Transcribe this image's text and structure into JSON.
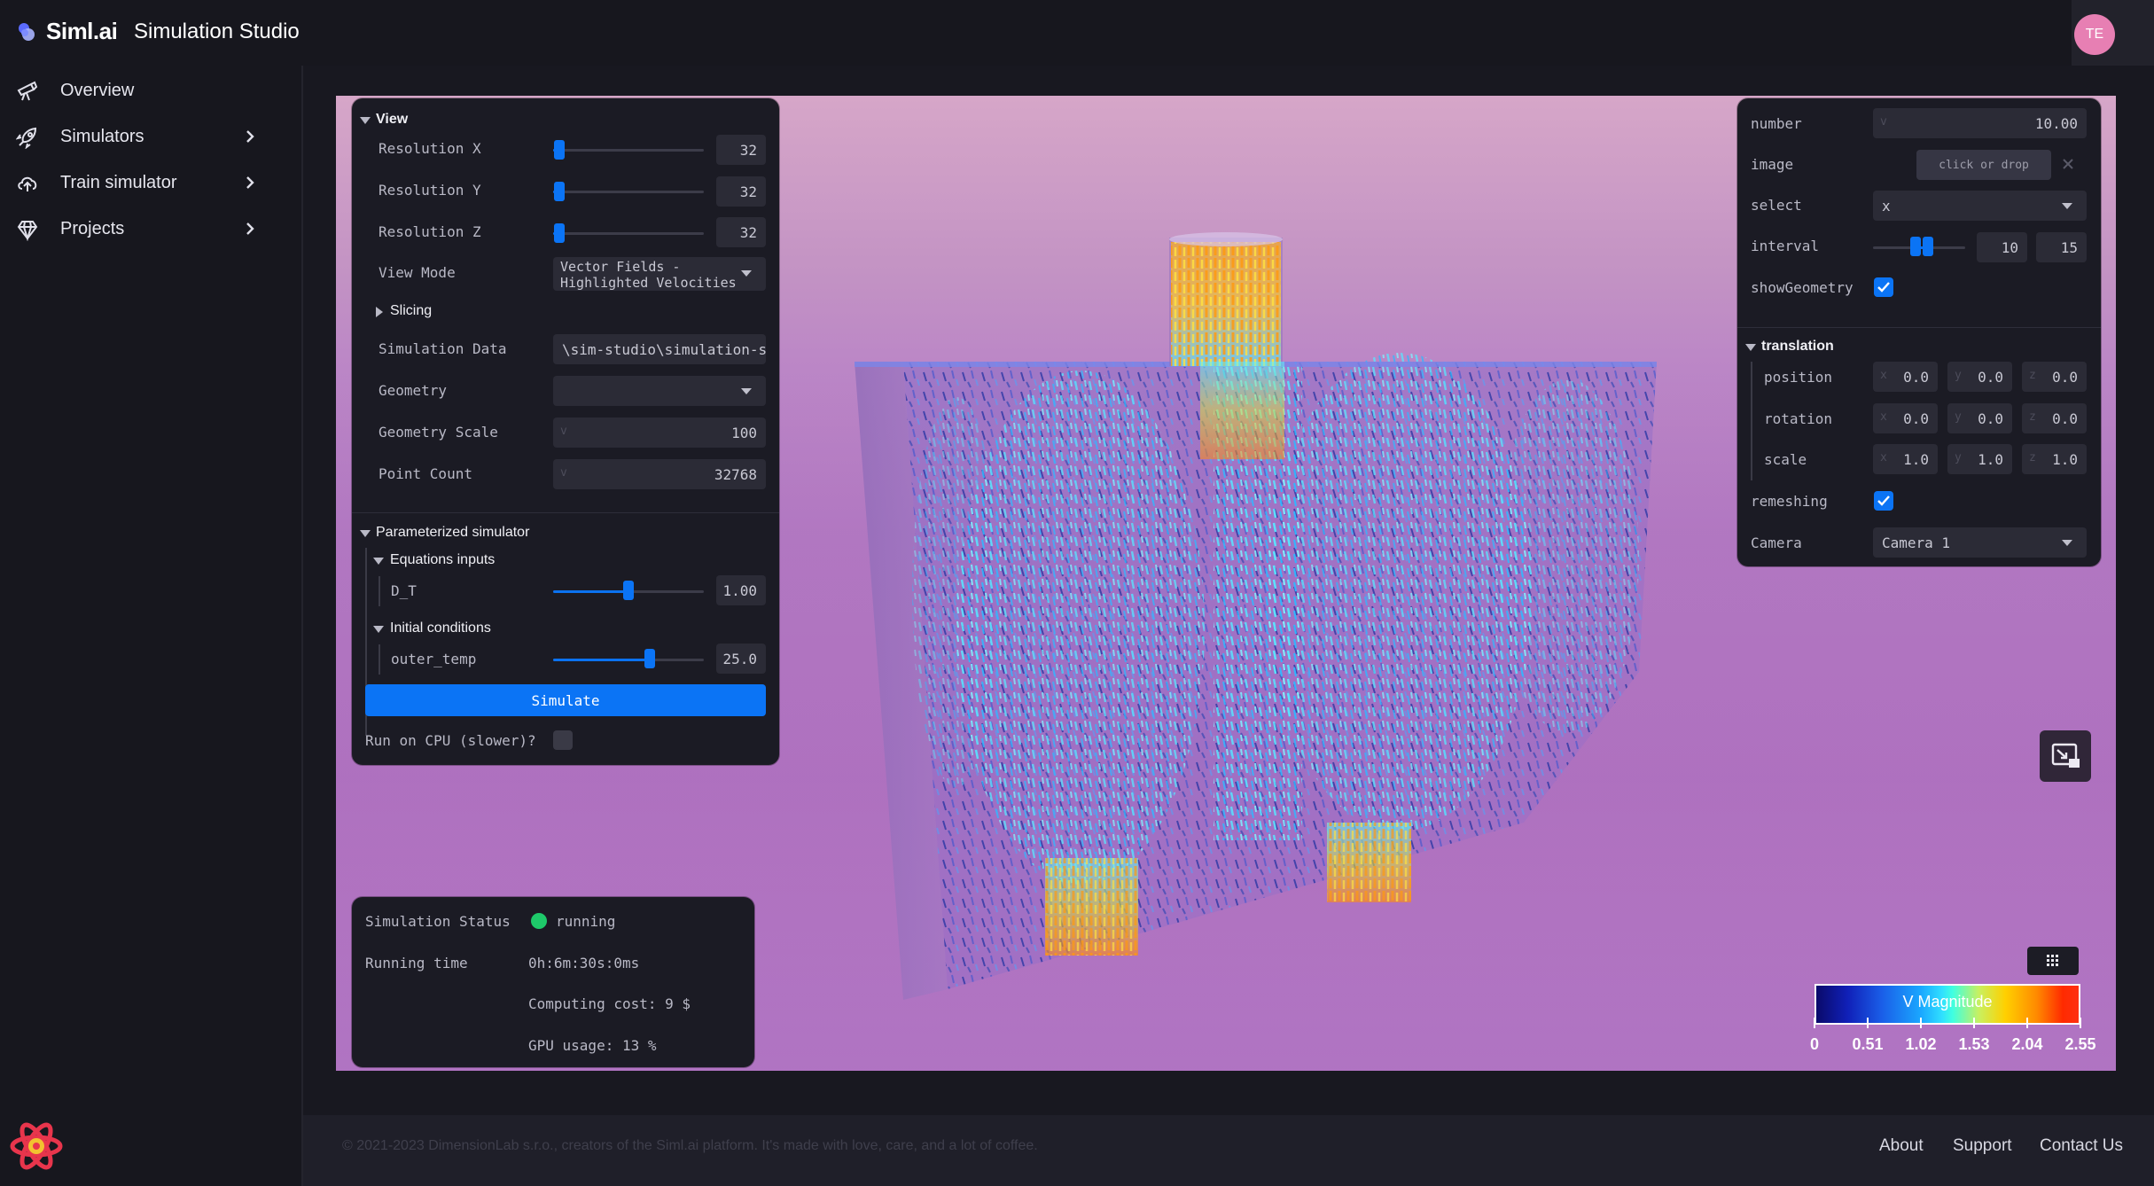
{
  "app": {
    "logo_text": "Siml.ai",
    "title": "Simulation Studio",
    "avatar_initials": "TE"
  },
  "sidebar": {
    "items": [
      {
        "label": "Overview",
        "icon": "telescope-icon",
        "has_chevron": false
      },
      {
        "label": "Simulators",
        "icon": "rocket-icon",
        "has_chevron": true
      },
      {
        "label": "Train simulator",
        "icon": "cloud-upload-icon",
        "has_chevron": true
      },
      {
        "label": "Projects",
        "icon": "diamond-icon",
        "has_chevron": true
      }
    ]
  },
  "view_panel": {
    "title": "View",
    "resolution_x": {
      "label": "Resolution X",
      "value": "32",
      "fraction": 0.04
    },
    "resolution_y": {
      "label": "Resolution Y",
      "value": "32",
      "fraction": 0.04
    },
    "resolution_z": {
      "label": "Resolution Z",
      "value": "32",
      "fraction": 0.04
    },
    "view_mode": {
      "label": "View Mode",
      "value_line1": "Vector Fields -",
      "value_line2": "Highlighted Velocities"
    },
    "slicing": "Slicing",
    "simulation_data": {
      "label": "Simulation Data",
      "value": "\\sim-studio\\simulation-st"
    },
    "geometry": {
      "label": "Geometry",
      "value": ""
    },
    "geometry_scale": {
      "label": "Geometry Scale",
      "value": "100",
      "axis": "v"
    },
    "point_count": {
      "label": "Point Count",
      "value": "32768",
      "axis": "v"
    },
    "param_sim": {
      "title": "Parameterized simulator",
      "equations_title": "Equations inputs",
      "dt": {
        "label": "D_T",
        "value": "1.00",
        "fraction": 0.5
      },
      "initial_title": "Initial conditions",
      "outer_temp": {
        "label": "outer_temp",
        "value": "25.0",
        "fraction": 0.64
      }
    },
    "simulate_label": "Simulate",
    "cpu_label": "Run on CPU (slower)?"
  },
  "right_panel": {
    "number": {
      "label": "number",
      "value": "10.00",
      "axis": "v"
    },
    "image": {
      "label": "image",
      "placeholder": "click or drop"
    },
    "select": {
      "label": "select",
      "value": "x"
    },
    "interval": {
      "label": "interval",
      "min": "10",
      "max": "15",
      "low_fraction": 0.46,
      "high_fraction": 0.6
    },
    "show_geometry": {
      "label": "showGeometry",
      "checked": true
    },
    "translation": {
      "title": "translation",
      "position": {
        "label": "position",
        "x": "0.0",
        "y": "0.0",
        "z": "0.0"
      },
      "rotation": {
        "label": "rotation",
        "x": "0.0",
        "y": "0.0",
        "z": "0.0"
      },
      "scale": {
        "label": "scale",
        "x": "1.0",
        "y": "1.0",
        "z": "1.0"
      },
      "axis_x": "x",
      "axis_y": "y",
      "axis_z": "z"
    },
    "remeshing": {
      "label": "remeshing",
      "checked": true
    },
    "camera": {
      "label": "Camera",
      "value": "Camera 1"
    }
  },
  "status_panel": {
    "status_label": "Simulation Status",
    "status_value": "running",
    "status_color": "#1ec96a",
    "running_time_label": "Running time",
    "running_time_value": "0h:6m:30s:0ms",
    "computing_cost": "Computing cost: 9 $",
    "gpu_usage": "GPU usage: 13 %"
  },
  "legend": {
    "title": "V Magnitude",
    "ticks": [
      "0",
      "0.51",
      "1.02",
      "1.53",
      "2.04",
      "2.55"
    ]
  },
  "footer": {
    "copyright": "© 2021-2023 DimensionLab s.r.o., creators of the Siml.ai platform. It's made with love, care, and a lot of coffee.",
    "links": [
      "About",
      "Support",
      "Contact Us"
    ]
  },
  "colors": {
    "accent": "#0b74f5",
    "background": "#181820",
    "panel": "#1b1b24",
    "viewport_sky": "#b47ac4"
  }
}
